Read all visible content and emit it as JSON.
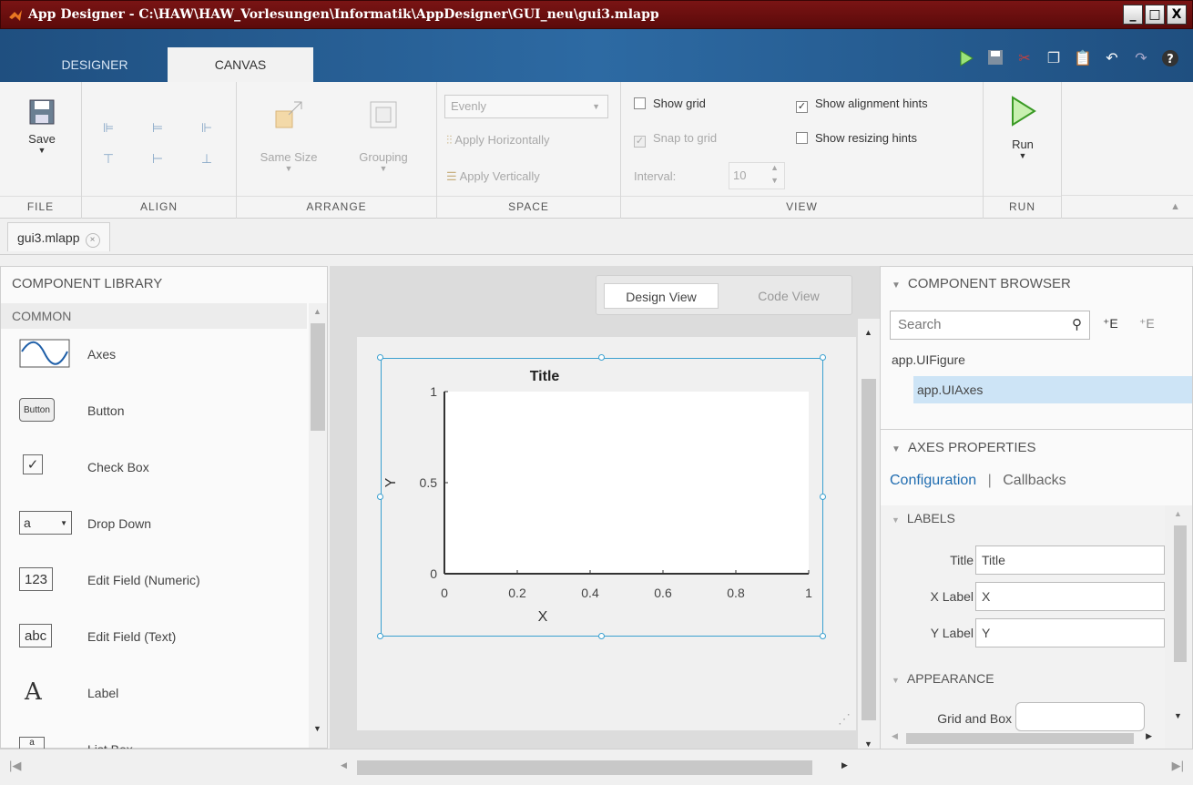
{
  "window": {
    "title": "App Designer - C:\\HAW\\HAW_Vorlesungen\\Informatik\\AppDesigner\\GUI_neu\\gui3.mlapp",
    "minimize": "_",
    "maximize": "□",
    "close": "X"
  },
  "tabs": {
    "designer": "DESIGNER",
    "canvas": "CANVAS"
  },
  "ribbon": {
    "file": {
      "label": "FILE",
      "save": "Save"
    },
    "align": {
      "label": "ALIGN"
    },
    "arrange": {
      "label": "ARRANGE",
      "same_size": "Same Size",
      "grouping": "Grouping"
    },
    "space": {
      "label": "SPACE",
      "dropdown": "Evenly",
      "apply_h": "Apply Horizontally",
      "apply_v": "Apply Vertically"
    },
    "view": {
      "label": "VIEW",
      "show_grid": "Show grid",
      "snap_to_grid": "Snap to grid",
      "interval_label": "Interval:",
      "interval_value": "10",
      "show_alignment": "Show alignment hints",
      "show_resizing": "Show resizing hints"
    },
    "run": {
      "label": "RUN",
      "run": "Run"
    }
  },
  "file_tab": {
    "name": "gui3.mlapp",
    "close": "×"
  },
  "library": {
    "title": "COMPONENT LIBRARY",
    "section": "COMMON",
    "items": [
      {
        "label": "Axes",
        "icon": "axes-icon"
      },
      {
        "label": "Button",
        "icon_text": "Button"
      },
      {
        "label": "Check Box",
        "icon_text": "✓"
      },
      {
        "label": "Drop Down",
        "icon_text": "a"
      },
      {
        "label": "Edit Field (Numeric)",
        "icon_text": "123"
      },
      {
        "label": "Edit Field (Text)",
        "icon_text": "abc"
      },
      {
        "label": "Label",
        "icon_text": "A"
      },
      {
        "label": "List Box",
        "icon_text": "a"
      }
    ]
  },
  "canvas": {
    "design_view": "Design View",
    "code_view": "Code View"
  },
  "chart_data": {
    "type": "line",
    "title": "Title",
    "xlabel": "X",
    "ylabel": "Y",
    "xlim": [
      0,
      1
    ],
    "ylim": [
      0,
      1
    ],
    "xticks": [
      "0",
      "0.2",
      "0.4",
      "0.6",
      "0.8",
      "1"
    ],
    "yticks": [
      "0",
      "0.5",
      "1"
    ],
    "series": []
  },
  "browser": {
    "title": "COMPONENT BROWSER",
    "search_placeholder": "Search",
    "tree": [
      "app.UIFigure",
      "app.UIAxes"
    ]
  },
  "properties": {
    "title": "AXES PROPERTIES",
    "tab_config": "Configuration",
    "tab_sep": "|",
    "tab_callbacks": "Callbacks",
    "labels_section": "LABELS",
    "title_label": "Title",
    "title_value": "Title",
    "xlabel_label": "X Label",
    "xlabel_value": "X",
    "ylabel_label": "Y Label",
    "ylabel_value": "Y",
    "appearance_section": "APPEARANCE",
    "grid_label": "Grid and Box"
  }
}
